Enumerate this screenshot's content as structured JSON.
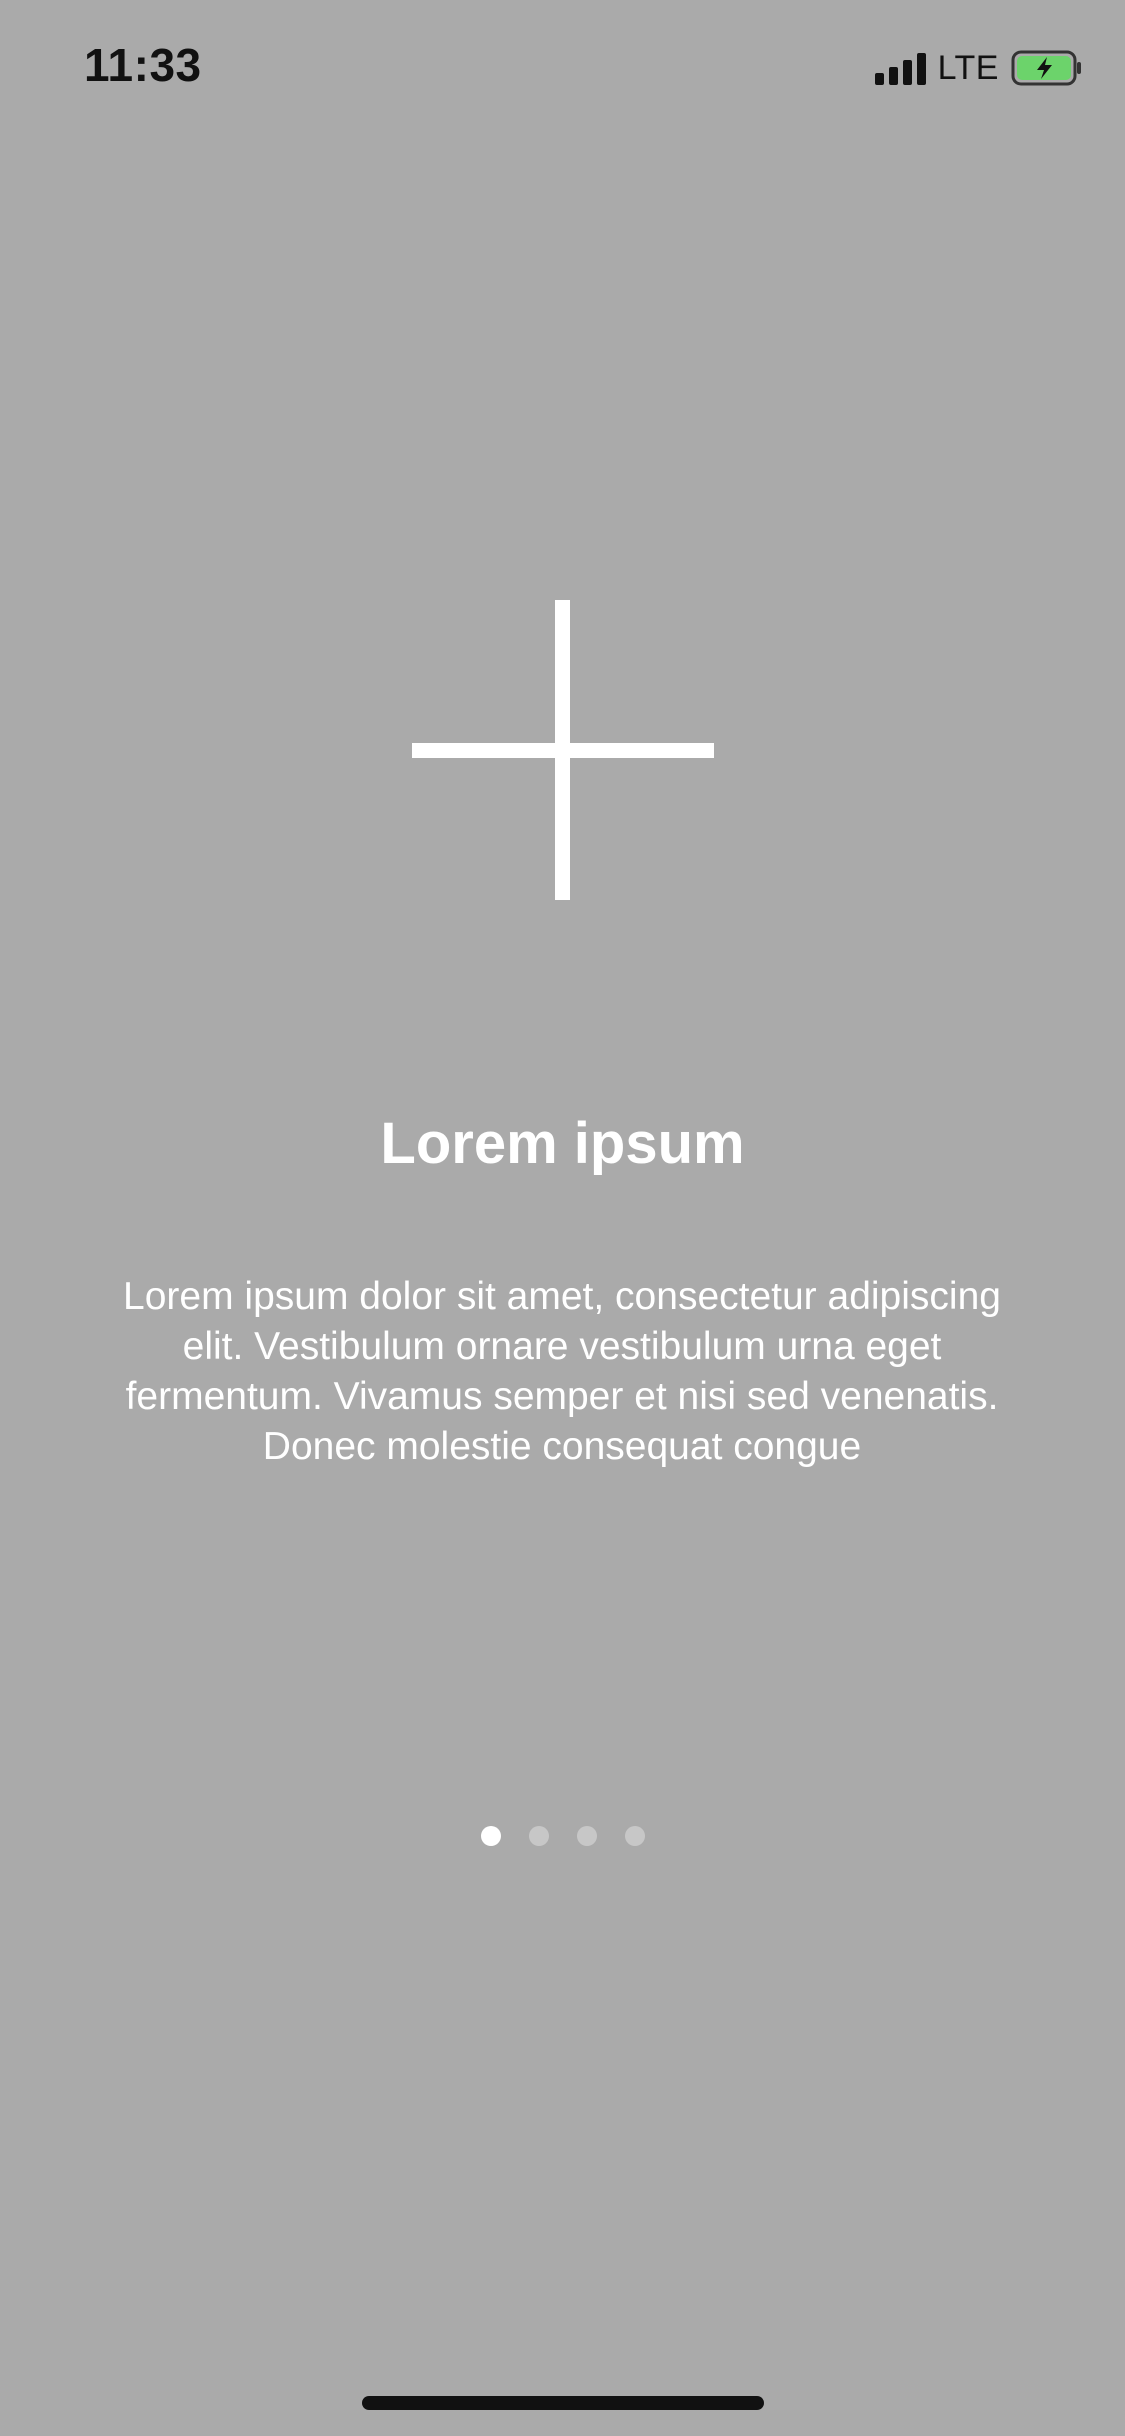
{
  "status_bar": {
    "time": "11:33",
    "network": "LTE",
    "battery_color": "#6cd36b"
  },
  "icon": {
    "name": "plus-icon",
    "color": "#ffffff"
  },
  "content": {
    "title": "Lorem ipsum",
    "body": "Lorem ipsum dolor sit amet, consectetur adipiscing elit. Vestibulum ornare vestibulum urna eget fermentum. Vivamus semper et nisi sed venenatis. Donec molestie consequat congue"
  },
  "pager": {
    "page_count": 4,
    "current_page": 1
  },
  "colors": {
    "background": "#aaaaaa",
    "text": "#ffffff",
    "status_text": "#111111"
  }
}
